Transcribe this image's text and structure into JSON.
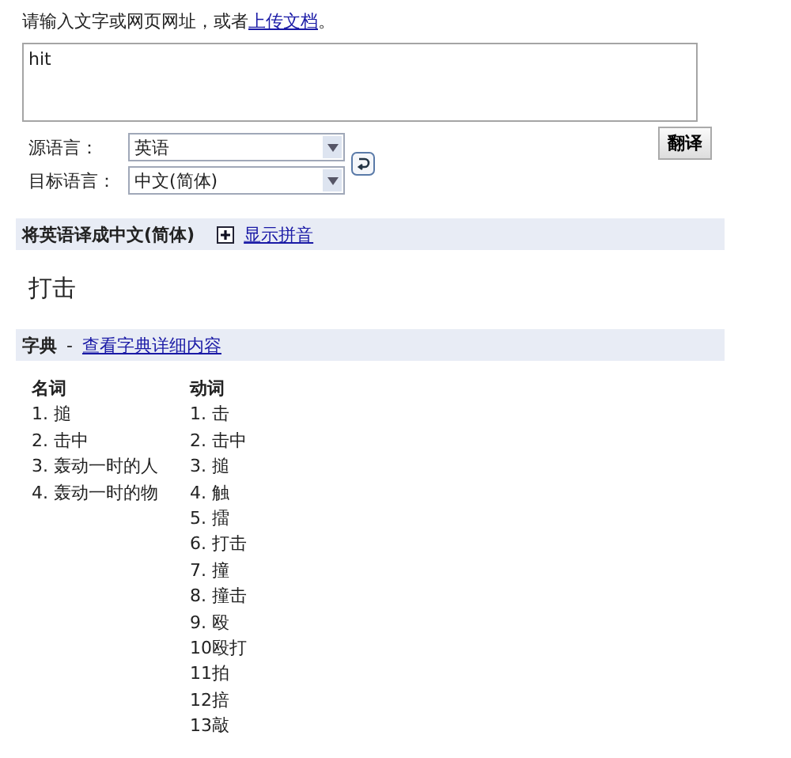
{
  "intro": {
    "text": "请输入文字或网页网址，或者",
    "link": "上传文档",
    "end": "。"
  },
  "input": {
    "value": "hit"
  },
  "source_language": {
    "label": "源语言：",
    "value": "英语"
  },
  "target_language": {
    "label": "目标语言：",
    "value": "中文(简体)"
  },
  "translate_button": "翻译",
  "result_header": {
    "title": "将英语译成中文(简体)",
    "link": "显示拼音"
  },
  "result": "打击",
  "dictionary_header": {
    "title": "字典",
    "separator": "-",
    "link": "查看字典详细内容"
  },
  "dictionary": [
    {
      "heading": "名词",
      "entries": [
        "1. 搥",
        "2. 击中",
        "3. 轰动一时的人",
        "4. 轰动一时的物"
      ]
    },
    {
      "heading": "动词",
      "entries": [
        "1. 击",
        "2. 击中",
        "3. 搥",
        "4. 触",
        "5. 擂",
        "6. 打击",
        "7. 撞",
        "8. 撞击",
        "9. 殴",
        "10殴打",
        "11拍",
        "12掊",
        "13敲"
      ]
    }
  ]
}
